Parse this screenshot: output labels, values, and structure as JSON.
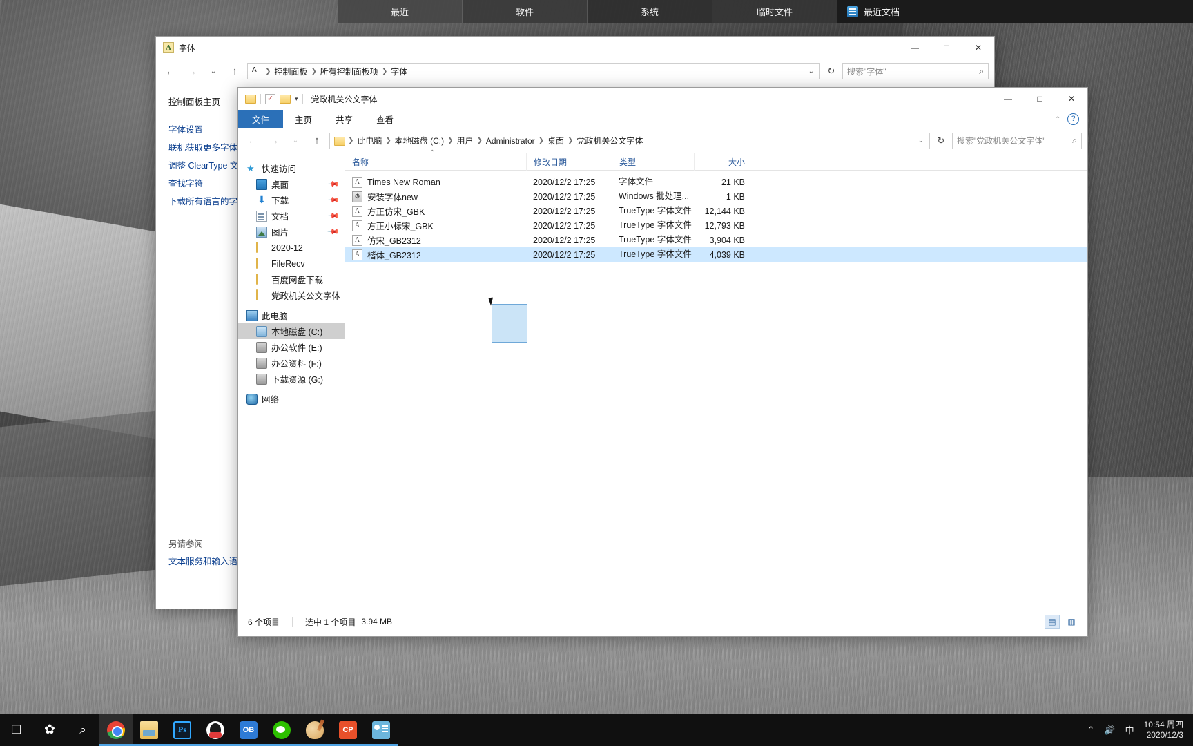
{
  "topbar": {
    "tabs": [
      {
        "label": "最近"
      },
      {
        "label": "软件"
      },
      {
        "label": "系统"
      },
      {
        "label": "临时文件"
      }
    ],
    "right_label": "最近文档"
  },
  "control_panel": {
    "title": "字体",
    "icon": "font-a-icon",
    "breadcrumb": [
      "控制面板",
      "所有控制面板项",
      "字体"
    ],
    "search_placeholder": "搜索\"字体\"",
    "window_buttons": {
      "minimize": "—",
      "maximize": "□",
      "close": "✕"
    },
    "sidebar": {
      "home": "控制面板主页",
      "links": [
        "字体设置",
        "联机获取更多字体",
        "调整 ClearType 文本",
        "查找字符",
        "下载所有语言的字体"
      ],
      "see_also_label": "另请参阅",
      "see_also_links": [
        "文本服务和输入语言"
      ]
    }
  },
  "explorer": {
    "title": "党政机关公文字体",
    "quick_access_icons": [
      "folder-icon",
      "properties-icon",
      "new-folder-icon",
      "chevron-down-icon"
    ],
    "window_buttons": {
      "minimize": "—",
      "maximize": "□",
      "close": "✕"
    },
    "ribbon_tabs": [
      {
        "label": "文件",
        "active": true
      },
      {
        "label": "主页",
        "active": false
      },
      {
        "label": "共享",
        "active": false
      },
      {
        "label": "查看",
        "active": false
      }
    ],
    "ribbon_collapse": "⌃",
    "help": "?",
    "breadcrumb": [
      "此电脑",
      "本地磁盘 (C:)",
      "用户",
      "Administrator",
      "桌面",
      "党政机关公文字体"
    ],
    "search_placeholder": "搜索\"党政机关公文字体\"",
    "nav_items": [
      {
        "label": "快速访问",
        "icon": "star-pin-icon",
        "level": 1,
        "pinned": false,
        "selected": false
      },
      {
        "label": "桌面",
        "icon": "desktop-icon",
        "level": 2,
        "pinned": true,
        "selected": false
      },
      {
        "label": "下载",
        "icon": "downloads-icon",
        "level": 2,
        "pinned": true,
        "selected": false
      },
      {
        "label": "文档",
        "icon": "documents-icon",
        "level": 2,
        "pinned": true,
        "selected": false
      },
      {
        "label": "图片",
        "icon": "pictures-icon",
        "level": 2,
        "pinned": true,
        "selected": false
      },
      {
        "label": "2020-12",
        "icon": "folder-icon",
        "level": 2,
        "pinned": false,
        "selected": false
      },
      {
        "label": "FileRecv",
        "icon": "folder-icon",
        "level": 2,
        "pinned": false,
        "selected": false
      },
      {
        "label": "百度网盘下载",
        "icon": "folder-icon",
        "level": 2,
        "pinned": false,
        "selected": false
      },
      {
        "label": "党政机关公文字体",
        "icon": "folder-icon",
        "level": 2,
        "pinned": false,
        "selected": false
      },
      {
        "label": "此电脑",
        "icon": "this-pc-icon",
        "level": 1,
        "pinned": false,
        "selected": false
      },
      {
        "label": "本地磁盘 (C:)",
        "icon": "system-drive-icon",
        "level": 2,
        "pinned": false,
        "selected": true
      },
      {
        "label": "办公软件 (E:)",
        "icon": "drive-icon",
        "level": 2,
        "pinned": false,
        "selected": false
      },
      {
        "label": "办公资料 (F:)",
        "icon": "drive-icon",
        "level": 2,
        "pinned": false,
        "selected": false
      },
      {
        "label": "下载资源 (G:)",
        "icon": "drive-icon",
        "level": 2,
        "pinned": false,
        "selected": false
      },
      {
        "label": "网络",
        "icon": "network-icon",
        "level": 1,
        "pinned": false,
        "selected": false
      }
    ],
    "columns": [
      {
        "key": "name",
        "label": "名称",
        "sorted": true,
        "sort_dir": "asc"
      },
      {
        "key": "date",
        "label": "修改日期",
        "sorted": false
      },
      {
        "key": "type",
        "label": "类型",
        "sorted": false
      },
      {
        "key": "size",
        "label": "大小",
        "sorted": false
      }
    ],
    "files": [
      {
        "name": "Times New Roman",
        "date": "2020/12/2 17:25",
        "type": "字体文件",
        "size": "21 KB",
        "icon": "font-file-icon",
        "selected": false
      },
      {
        "name": "安装字体new",
        "date": "2020/12/2 17:25",
        "type": "Windows 批处理...",
        "size": "1 KB",
        "icon": "batch-file-icon",
        "selected": false
      },
      {
        "name": "方正仿宋_GBK",
        "date": "2020/12/2 17:25",
        "type": "TrueType 字体文件",
        "size": "12,144 KB",
        "icon": "font-file-icon",
        "selected": false
      },
      {
        "name": "方正小标宋_GBK",
        "date": "2020/12/2 17:25",
        "type": "TrueType 字体文件",
        "size": "12,793 KB",
        "icon": "font-file-icon",
        "selected": false
      },
      {
        "name": "仿宋_GB2312",
        "date": "2020/12/2 17:25",
        "type": "TrueType 字体文件",
        "size": "3,904 KB",
        "icon": "font-file-icon",
        "selected": false
      },
      {
        "name": "楷体_GB2312",
        "date": "2020/12/2 17:25",
        "type": "TrueType 字体文件",
        "size": "4,039 KB",
        "icon": "font-file-icon",
        "selected": true
      }
    ],
    "status": {
      "item_count": "6 个项目",
      "selection": "选中 1 个项目",
      "selection_size": "3.94 MB"
    },
    "view_buttons": [
      {
        "name": "details-view",
        "glyph": "▤",
        "active": true
      },
      {
        "name": "large-icons-view",
        "glyph": "▥",
        "active": false
      }
    ]
  },
  "taskbar": {
    "items": [
      {
        "name": "task-view-button",
        "icon": "task-view-icon",
        "glyph": "❏",
        "running": false
      },
      {
        "name": "pinwheel-button",
        "icon": "pinwheel-icon",
        "glyph": "✿",
        "running": false
      },
      {
        "name": "search-button",
        "icon": "search-icon",
        "glyph": "🔍",
        "running": false
      },
      {
        "name": "chrome-button",
        "icon": "chrome-icon",
        "glyph": "",
        "running": true
      },
      {
        "name": "file-explorer-button",
        "icon": "file-explorer-icon",
        "glyph": "",
        "running": true
      },
      {
        "name": "photoshop-button",
        "icon": "photoshop-icon",
        "glyph": "Ps",
        "running": true
      },
      {
        "name": "qq-button",
        "icon": "qq-icon",
        "glyph": "",
        "running": true
      },
      {
        "name": "ob-button",
        "icon": "ob-icon",
        "glyph": "OB",
        "running": true
      },
      {
        "name": "wechat-button",
        "icon": "wechat-icon",
        "glyph": "",
        "running": true
      },
      {
        "name": "paint-button",
        "icon": "paint-icon",
        "glyph": "",
        "running": true
      },
      {
        "name": "cp-button",
        "icon": "cp-icon",
        "glyph": "CP",
        "running": true
      },
      {
        "name": "card-app-button",
        "icon": "card-app-icon",
        "glyph": "",
        "running": true
      }
    ],
    "tray": {
      "chevron": "⌃",
      "volume": "🔊",
      "ime": "中",
      "time": "10:54 周四",
      "date": "2020/12/3"
    }
  }
}
